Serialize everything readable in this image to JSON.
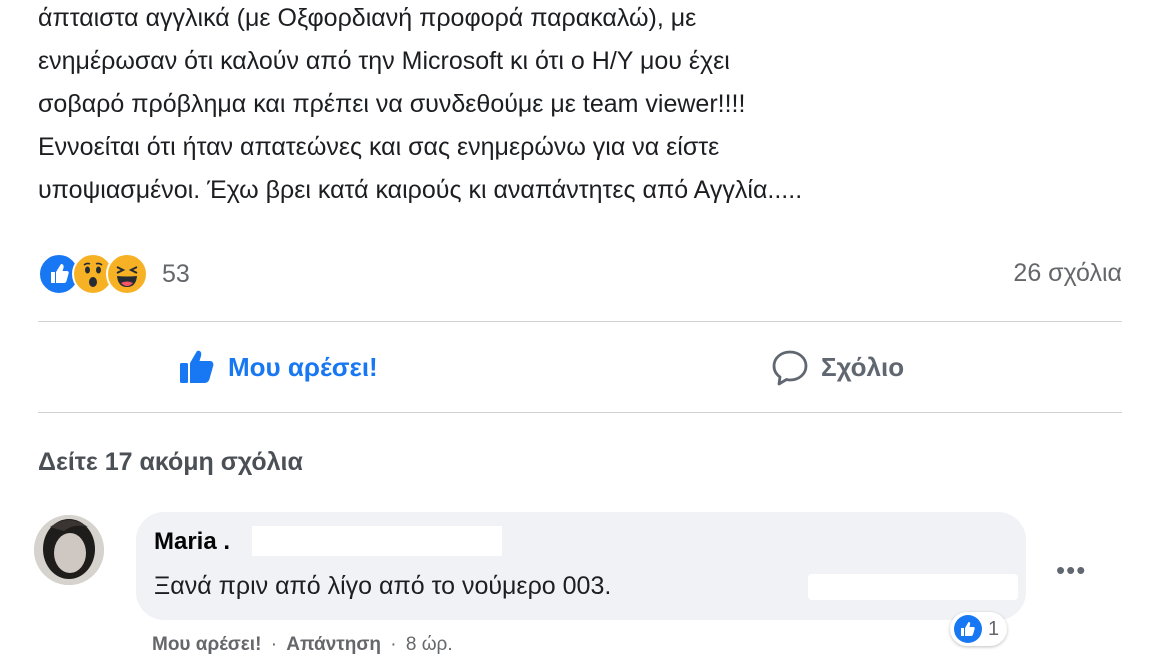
{
  "post": {
    "lines": [
      "άπταιστα αγγλικά (με Οξφορδιανή προφορά παρακαλώ),  με",
      "ενημέρωσαν ότι καλούν από την Microsoft κι ότι ο Η/Υ μου έχει",
      "σοβαρό πρόβλημα και πρέπει να συνδεθούμε με team viewer!!!!",
      "Εννοείται ότι ήταν απατεώνες και σας ενημερώνω για να είστε",
      "υποψιασμένοι. Έχω βρει κατά καιρούς κι αναπάντητες  από Αγγλία....."
    ]
  },
  "stats": {
    "reaction_icons": [
      "like-icon",
      "wow-icon",
      "haha-icon"
    ],
    "reactions_count": "53",
    "comments_count": "26 σχόλια"
  },
  "actions": {
    "like_label": "Μου αρέσει!",
    "comment_label": "Σχόλιο"
  },
  "comments_section": {
    "view_more": "Δείτε 17 ακόμη σχόλια",
    "comment": {
      "author": "Maria .",
      "text": "Ξανά πριν από λίγο από το νούμερο 003.",
      "more_icon": "more-horizontal-icon",
      "like_link": "Μου αρέσει!",
      "reply_link": "Απάντηση",
      "separator": "·",
      "time": "8 ώρ.",
      "reaction_count": "1"
    }
  },
  "colors": {
    "accent": "#1877f2",
    "text": "#1c1e21",
    "secondary_text": "#65676b",
    "bubble": "#f0f2f5"
  }
}
